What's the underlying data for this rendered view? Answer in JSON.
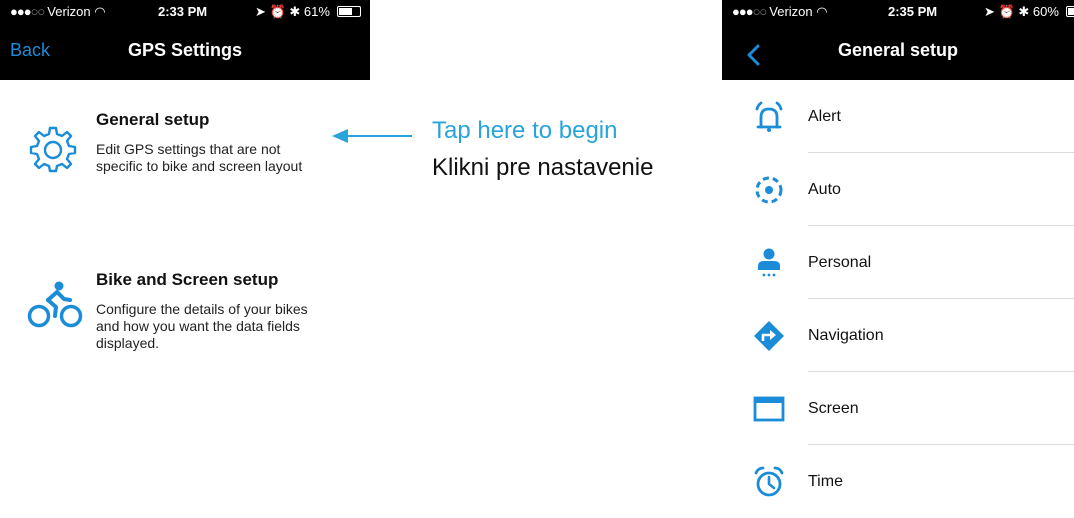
{
  "left_screen": {
    "status": {
      "carrier": "Verizon",
      "time": "2:33 PM",
      "battery": "61%",
      "battery_level": 0.61
    },
    "nav": {
      "back_label": "Back",
      "title": "GPS Settings"
    },
    "items": [
      {
        "title": "General setup",
        "description": "Edit GPS settings that are not specific to bike and screen layout",
        "icon": "gear-icon"
      },
      {
        "title": "Bike and Screen setup",
        "description": "Configure the details of your bikes and how you want the data fields displayed.",
        "icon": "cyclist-icon"
      }
    ]
  },
  "annotation": {
    "english": "Tap here to begin",
    "slovak": "Klikni pre nastavenie",
    "color": "#29a3dc"
  },
  "right_screen": {
    "status": {
      "carrier": "Verizon",
      "time": "2:35 PM",
      "battery": "60%",
      "battery_level": 0.6
    },
    "nav": {
      "title": "General setup"
    },
    "menu": [
      {
        "label": "Alert",
        "icon": "alarm-bell-icon"
      },
      {
        "label": "Auto",
        "icon": "auto-target-icon"
      },
      {
        "label": "Personal",
        "icon": "person-icon"
      },
      {
        "label": "Navigation",
        "icon": "navigation-diamond-icon"
      },
      {
        "label": "Screen",
        "icon": "screen-icon"
      },
      {
        "label": "Time",
        "icon": "alarm-clock-icon"
      }
    ]
  },
  "colors": {
    "accent": "#1a8cd8",
    "bar": "#000000"
  }
}
